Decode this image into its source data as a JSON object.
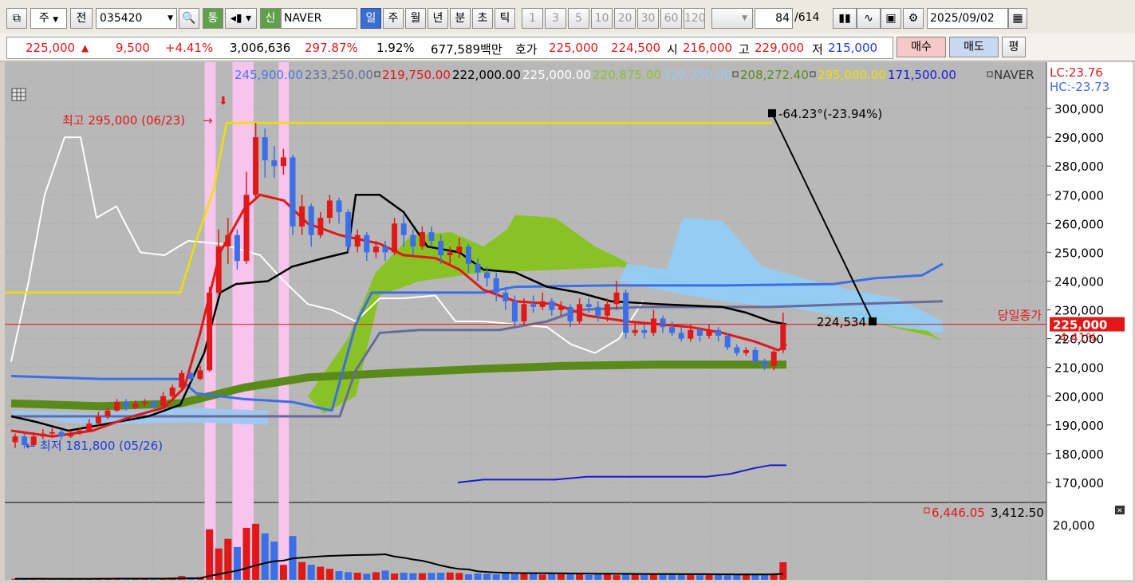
{
  "toolbar": {
    "mode_label": "주",
    "prev_label": "전",
    "code_value": "035420",
    "tong_label": "통",
    "sin_label": "신",
    "stock_name": "NAVER",
    "periods": [
      "일",
      "주",
      "월",
      "년",
      "분",
      "초",
      "틱"
    ],
    "minute_options": [
      "1",
      "3",
      "5",
      "10",
      "20",
      "30",
      "60",
      "120"
    ],
    "count_value": "84",
    "count_total": "/614",
    "date_value": "2025/09/02"
  },
  "quote": {
    "price": "225,000",
    "change": "9,500",
    "change_pct": "+4.41%",
    "volume": "3,006,636",
    "vol_ratio": "297.87%",
    "turnover": "1.92%",
    "amount": "677,589백만",
    "hoga_label": "호가",
    "ask": "225,000",
    "bid": "224,500",
    "open_label": "시",
    "open": "216,000",
    "high_label": "고",
    "high": "229,000",
    "low_label": "저",
    "low": "215,000",
    "buy_label": "매수",
    "sell_label": "매도",
    "eval_label": "평"
  },
  "legend": {
    "values": [
      {
        "text": "245,900.00",
        "color": "#4a78e6"
      },
      {
        "text": "233,250.00",
        "color": "#6a6a9a"
      },
      {
        "text": "219,750.00",
        "color": "#e01818",
        "box": true
      },
      {
        "text": "222,000.00",
        "color": "#000000"
      },
      {
        "text": "225,000.00",
        "color": "#ffffff"
      },
      {
        "text": "220,875.00",
        "color": "#8cc02a"
      },
      {
        "text": "229,250.00",
        "color": "#9cc8f0"
      },
      {
        "text": "208,272.40",
        "color": "#5a8a1a",
        "box": true
      },
      {
        "text": "295,000.00",
        "color": "#f0e000",
        "box": true
      },
      {
        "text": "171,500.00",
        "color": "#1a1ad0"
      }
    ],
    "name": "NAVER",
    "lc": "LC:23.76",
    "hc": "HC:-23.73"
  },
  "annotations": {
    "high_text": "최고 295,000 (06/23)",
    "low_text": "최저 181,800 (05/26)",
    "trend_text": "-64.23°(-23.94%)",
    "trend_end_value": "224,534",
    "close_label": "당일종가",
    "close_price": "225,000",
    "close_pct": "4.41%"
  },
  "volume_legend": {
    "v1": "6,446.05",
    "v2": "3,412.50",
    "axis": "20,000"
  },
  "colors": {
    "up": "#e01818",
    "down": "#3c6ee8",
    "ma5": "#e01818",
    "ma20": "#000000",
    "highline": "#f0e000",
    "chart_bg": "#b8b8b8"
  },
  "chart_data": {
    "type": "candlestick",
    "y_axis_ticks": [
      "300,000",
      "290,000",
      "280,000",
      "270,000",
      "260,000",
      "250,000",
      "240,000",
      "230,000",
      "220,000",
      "210,000",
      "200,000",
      "190,000",
      "180,000",
      "170,000"
    ],
    "ylim": [
      165000,
      305000
    ],
    "candles": [
      {
        "o": 184000,
        "c": 186000,
        "h": 187000,
        "l": 182000
      },
      {
        "o": 186000,
        "c": 183000,
        "h": 187000,
        "l": 181800
      },
      {
        "o": 183000,
        "c": 186000,
        "h": 187500,
        "l": 182500
      },
      {
        "o": 186000,
        "c": 187000,
        "h": 188500,
        "l": 185000
      },
      {
        "o": 187000,
        "c": 187500,
        "h": 189000,
        "l": 186000
      },
      {
        "o": 187500,
        "c": 186000,
        "h": 188500,
        "l": 185000
      },
      {
        "o": 186000,
        "c": 187000,
        "h": 188000,
        "l": 185500
      },
      {
        "o": 187000,
        "c": 188000,
        "h": 189000,
        "l": 186500
      },
      {
        "o": 188000,
        "c": 190500,
        "h": 192000,
        "l": 187500
      },
      {
        "o": 190500,
        "c": 193000,
        "h": 194500,
        "l": 190000
      },
      {
        "o": 193000,
        "c": 195000,
        "h": 196000,
        "l": 192000
      },
      {
        "o": 195000,
        "c": 198000,
        "h": 199000,
        "l": 194500
      },
      {
        "o": 198000,
        "c": 196000,
        "h": 199000,
        "l": 195000
      },
      {
        "o": 196000,
        "c": 197500,
        "h": 198500,
        "l": 195500
      },
      {
        "o": 197500,
        "c": 198000,
        "h": 199000,
        "l": 196500
      },
      {
        "o": 198000,
        "c": 196500,
        "h": 198500,
        "l": 195500
      },
      {
        "o": 196500,
        "c": 200000,
        "h": 201500,
        "l": 196000
      },
      {
        "o": 200000,
        "c": 203000,
        "h": 204000,
        "l": 199500
      },
      {
        "o": 203000,
        "c": 208000,
        "h": 209000,
        "l": 202500
      },
      {
        "o": 208000,
        "c": 206000,
        "h": 208500,
        "l": 205000
      },
      {
        "o": 206000,
        "c": 209000,
        "h": 210500,
        "l": 205500
      },
      {
        "o": 209000,
        "c": 236000,
        "h": 238000,
        "l": 208500
      },
      {
        "o": 236000,
        "c": 252000,
        "h": 258000,
        "l": 235000
      },
      {
        "o": 252000,
        "c": 256000,
        "h": 262000,
        "l": 246000
      },
      {
        "o": 256000,
        "c": 247000,
        "h": 258000,
        "l": 244000
      },
      {
        "o": 247000,
        "c": 270000,
        "h": 278000,
        "l": 246000
      },
      {
        "o": 270000,
        "c": 290000,
        "h": 295000,
        "l": 268000
      },
      {
        "o": 290000,
        "c": 282000,
        "h": 293000,
        "l": 276000
      },
      {
        "o": 282000,
        "c": 280000,
        "h": 287000,
        "l": 276000
      },
      {
        "o": 280000,
        "c": 283000,
        "h": 286000,
        "l": 277000
      },
      {
        "o": 283000,
        "c": 259000,
        "h": 284000,
        "l": 256000
      },
      {
        "o": 259000,
        "c": 266000,
        "h": 270000,
        "l": 256000
      },
      {
        "o": 266000,
        "c": 256000,
        "h": 267000,
        "l": 252000
      },
      {
        "o": 256000,
        "c": 262000,
        "h": 264000,
        "l": 255000
      },
      {
        "o": 262000,
        "c": 268000,
        "h": 270000,
        "l": 260000
      },
      {
        "o": 268000,
        "c": 264000,
        "h": 269000,
        "l": 260000
      },
      {
        "o": 264000,
        "c": 252000,
        "h": 265000,
        "l": 250000
      },
      {
        "o": 252000,
        "c": 256000,
        "h": 258000,
        "l": 250000
      },
      {
        "o": 256000,
        "c": 250000,
        "h": 257000,
        "l": 247000
      },
      {
        "o": 250000,
        "c": 252000,
        "h": 254000,
        "l": 248000
      },
      {
        "o": 252000,
        "c": 250000,
        "h": 254000,
        "l": 247000
      },
      {
        "o": 250000,
        "c": 260000,
        "h": 262000,
        "l": 249000
      },
      {
        "o": 260000,
        "c": 256000,
        "h": 263000,
        "l": 252000
      },
      {
        "o": 256000,
        "c": 252000,
        "h": 258000,
        "l": 249000
      },
      {
        "o": 252000,
        "c": 257000,
        "h": 259000,
        "l": 251000
      },
      {
        "o": 257000,
        "c": 254000,
        "h": 259000,
        "l": 252000
      },
      {
        "o": 254000,
        "c": 249000,
        "h": 256000,
        "l": 246000
      },
      {
        "o": 249000,
        "c": 250000,
        "h": 252000,
        "l": 246000
      },
      {
        "o": 250000,
        "c": 252000,
        "h": 255000,
        "l": 248000
      },
      {
        "o": 252000,
        "c": 246000,
        "h": 253000,
        "l": 243000
      },
      {
        "o": 246000,
        "c": 243000,
        "h": 248000,
        "l": 240000
      },
      {
        "o": 243000,
        "c": 241000,
        "h": 245000,
        "l": 238000
      },
      {
        "o": 241000,
        "c": 236000,
        "h": 243000,
        "l": 233000
      },
      {
        "o": 236000,
        "c": 233000,
        "h": 238000,
        "l": 230000
      },
      {
        "o": 233000,
        "c": 226000,
        "h": 235000,
        "l": 224000
      },
      {
        "o": 226000,
        "c": 232000,
        "h": 234000,
        "l": 225000
      },
      {
        "o": 232000,
        "c": 231000,
        "h": 235000,
        "l": 229000
      },
      {
        "o": 231000,
        "c": 233000,
        "h": 236000,
        "l": 230000
      },
      {
        "o": 233000,
        "c": 230000,
        "h": 234000,
        "l": 228000
      },
      {
        "o": 230000,
        "c": 231000,
        "h": 233000,
        "l": 228000
      },
      {
        "o": 231000,
        "c": 226000,
        "h": 232000,
        "l": 224000
      },
      {
        "o": 226000,
        "c": 232000,
        "h": 234000,
        "l": 225000
      },
      {
        "o": 232000,
        "c": 231000,
        "h": 234000,
        "l": 229000
      },
      {
        "o": 231000,
        "c": 228000,
        "h": 233000,
        "l": 226000
      },
      {
        "o": 228000,
        "c": 232000,
        "h": 234000,
        "l": 226000
      },
      {
        "o": 232000,
        "c": 236000,
        "h": 240000,
        "l": 230000
      },
      {
        "o": 236000,
        "c": 222000,
        "h": 237000,
        "l": 220000
      },
      {
        "o": 222000,
        "c": 223000,
        "h": 226000,
        "l": 221000
      },
      {
        "o": 223000,
        "c": 222000,
        "h": 225000,
        "l": 220000
      },
      {
        "o": 222000,
        "c": 227000,
        "h": 230000,
        "l": 221000
      },
      {
        "o": 227000,
        "c": 224000,
        "h": 228000,
        "l": 222000
      },
      {
        "o": 224000,
        "c": 222000,
        "h": 226000,
        "l": 221000
      },
      {
        "o": 222000,
        "c": 220000,
        "h": 224000,
        "l": 219000
      },
      {
        "o": 220000,
        "c": 223000,
        "h": 225000,
        "l": 219000
      },
      {
        "o": 223000,
        "c": 221000,
        "h": 224000,
        "l": 219000
      },
      {
        "o": 221000,
        "c": 223000,
        "h": 225000,
        "l": 220000
      },
      {
        "o": 223000,
        "c": 221000,
        "h": 224000,
        "l": 219000
      },
      {
        "o": 221000,
        "c": 217000,
        "h": 222000,
        "l": 216000
      },
      {
        "o": 217000,
        "c": 215000,
        "h": 218000,
        "l": 214000
      },
      {
        "o": 215000,
        "c": 216000,
        "h": 217000,
        "l": 214000
      },
      {
        "o": 216000,
        "c": 212000,
        "h": 217000,
        "l": 211000
      },
      {
        "o": 212000,
        "c": 210500,
        "h": 213000,
        "l": 209000
      },
      {
        "o": 210500,
        "c": 215500,
        "h": 216000,
        "l": 209000
      },
      {
        "o": 216000,
        "c": 225000,
        "h": 229000,
        "l": 215000
      }
    ],
    "volume": [
      400,
      300,
      500,
      400,
      300,
      350,
      300,
      400,
      500,
      450,
      600,
      700,
      500,
      450,
      400,
      350,
      700,
      800,
      1400,
      900,
      1000,
      18500,
      11500,
      15000,
      12000,
      19000,
      20500,
      17000,
      14000,
      5500,
      16000,
      6500,
      5500,
      4800,
      4000,
      3200,
      2800,
      2600,
      2200,
      2800,
      3400,
      2300,
      2600,
      2400,
      2400,
      2500,
      2600,
      2700,
      2500,
      2000,
      2300,
      2200,
      2000,
      2400,
      2100,
      2300,
      2500,
      1900,
      2200,
      2100,
      2000,
      2400,
      1800,
      2000,
      2100,
      1700,
      2500,
      2200,
      1800,
      2000,
      2100,
      2000,
      1800,
      2200,
      1700,
      1800,
      1900,
      1700,
      1800,
      2200,
      2000,
      1900,
      2400,
      6446
    ],
    "volume_ylim": [
      0,
      26000
    ]
  }
}
